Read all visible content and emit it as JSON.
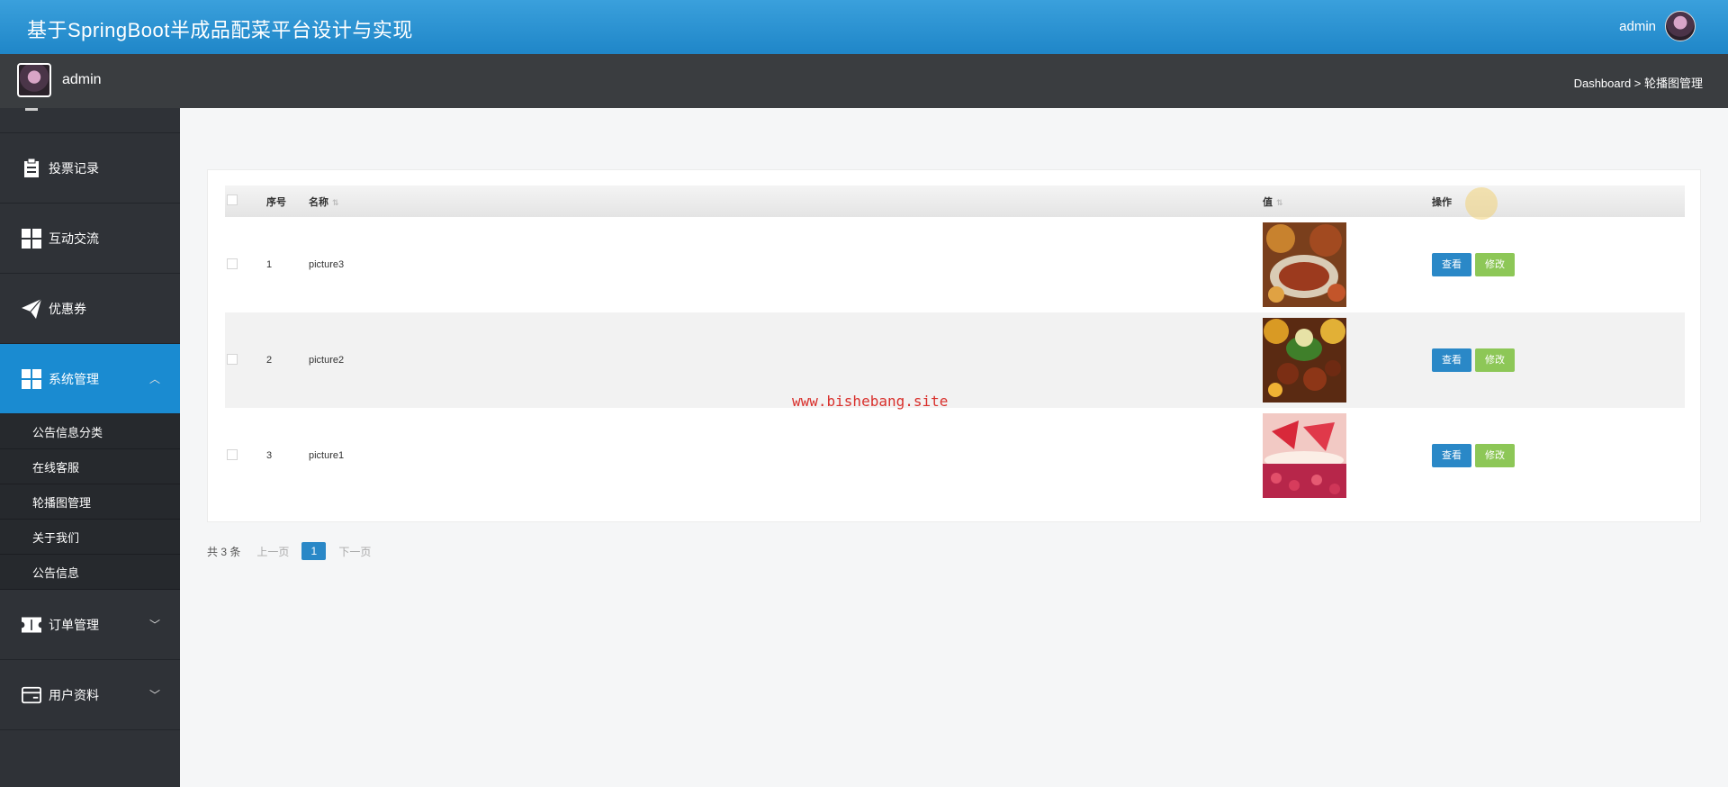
{
  "header": {
    "title": "基于SpringBoot半成品配菜平台设计与实现",
    "user": "admin"
  },
  "subheader": {
    "user": "admin",
    "breadcrumb": "Dashboard > 轮播图管理"
  },
  "sidebar": {
    "items": [
      {
        "label": "投票记录",
        "icon": "clipboard-icon"
      },
      {
        "label": "互动交流",
        "icon": "grid-icon"
      },
      {
        "label": "优惠券",
        "icon": "paper-plane-icon"
      },
      {
        "label": "系统管理",
        "icon": "grid-icon",
        "expanded": true
      }
    ],
    "subitems": [
      "公告信息分类",
      "在线客服",
      "轮播图管理",
      "关于我们",
      "公告信息"
    ],
    "items_after": [
      {
        "label": "订单管理",
        "icon": "ticket-icon"
      },
      {
        "label": "用户资料",
        "icon": "card-icon"
      }
    ]
  },
  "table": {
    "headers": {
      "index": "序号",
      "name": "名称",
      "value": "值",
      "actions": "操作"
    },
    "rows": [
      {
        "index": "1",
        "name": "picture3",
        "image": "food-photo"
      },
      {
        "index": "2",
        "name": "picture2",
        "image": "food-photo"
      },
      {
        "index": "3",
        "name": "picture1",
        "image": "food-photo"
      }
    ],
    "view_label": "查看",
    "edit_label": "修改"
  },
  "pager": {
    "total": "共 3 条",
    "prev": "上一页",
    "current": "1",
    "next": "下一页"
  },
  "watermark": "www.bishebang.site",
  "colors": {
    "header_blue": "#1f86c8",
    "sidebar": "#2f3237",
    "active": "#1a8bd1",
    "view_btn": "#2a88c7",
    "edit_btn": "#8dc757"
  }
}
